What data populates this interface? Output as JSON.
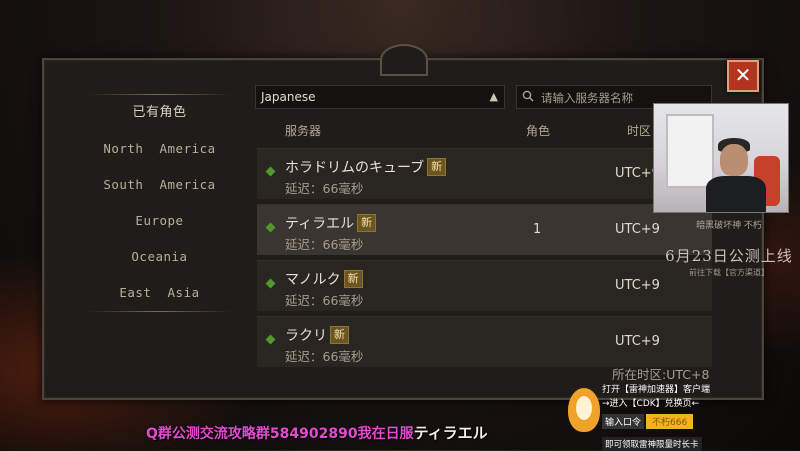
{
  "window": {
    "close_label": "✕"
  },
  "regions": {
    "items": [
      {
        "label": "已有角色"
      },
      {
        "label": "North  America"
      },
      {
        "label": "South  America"
      },
      {
        "label": "Europe"
      },
      {
        "label": "Oceania"
      },
      {
        "label": "East  Asia"
      }
    ]
  },
  "region_select": {
    "selected": "Japanese",
    "caret": "▲"
  },
  "search": {
    "placeholder": "请输入服务器名称",
    "icon": "search-icon"
  },
  "table": {
    "headers": {
      "server": "服务器",
      "characters": "角色",
      "timezone": "时区"
    },
    "rows": [
      {
        "name": "ホラドリムのキューブ",
        "badge": "新",
        "latency": "延迟：66毫秒",
        "characters": "",
        "timezone": "UTC+9"
      },
      {
        "name": "ティラエル",
        "badge": "新",
        "latency": "延迟：66毫秒",
        "characters": "1",
        "timezone": "UTC+9"
      },
      {
        "name": "マノルク",
        "badge": "新",
        "latency": "延迟：66毫秒",
        "characters": "",
        "timezone": "UTC+9"
      },
      {
        "name": "ラクリ",
        "badge": "新",
        "latency": "延迟：66毫秒",
        "characters": "",
        "timezone": "UTC+9"
      }
    ],
    "selected_index": 1,
    "status_color": "#4e9a2d"
  },
  "current_timezone": "所在时区:UTC+8",
  "overlay": {
    "promo": {
      "small": "暗黑破坏神 不朽",
      "date": "6月23日公测上线",
      "sub": "前往下载【官方渠道】"
    },
    "sponsor": {
      "line1": "打开【雷神加速器】客户端",
      "line2": "→进入【CDK】兑换页←",
      "code_label": "输入口令",
      "code_value": "不朽666",
      "line3": "即可领取雷神限量时长卡"
    },
    "ticker": {
      "text": "Q群公测交流攻略群584902890我在日服",
      "server": "ティラエル"
    }
  }
}
